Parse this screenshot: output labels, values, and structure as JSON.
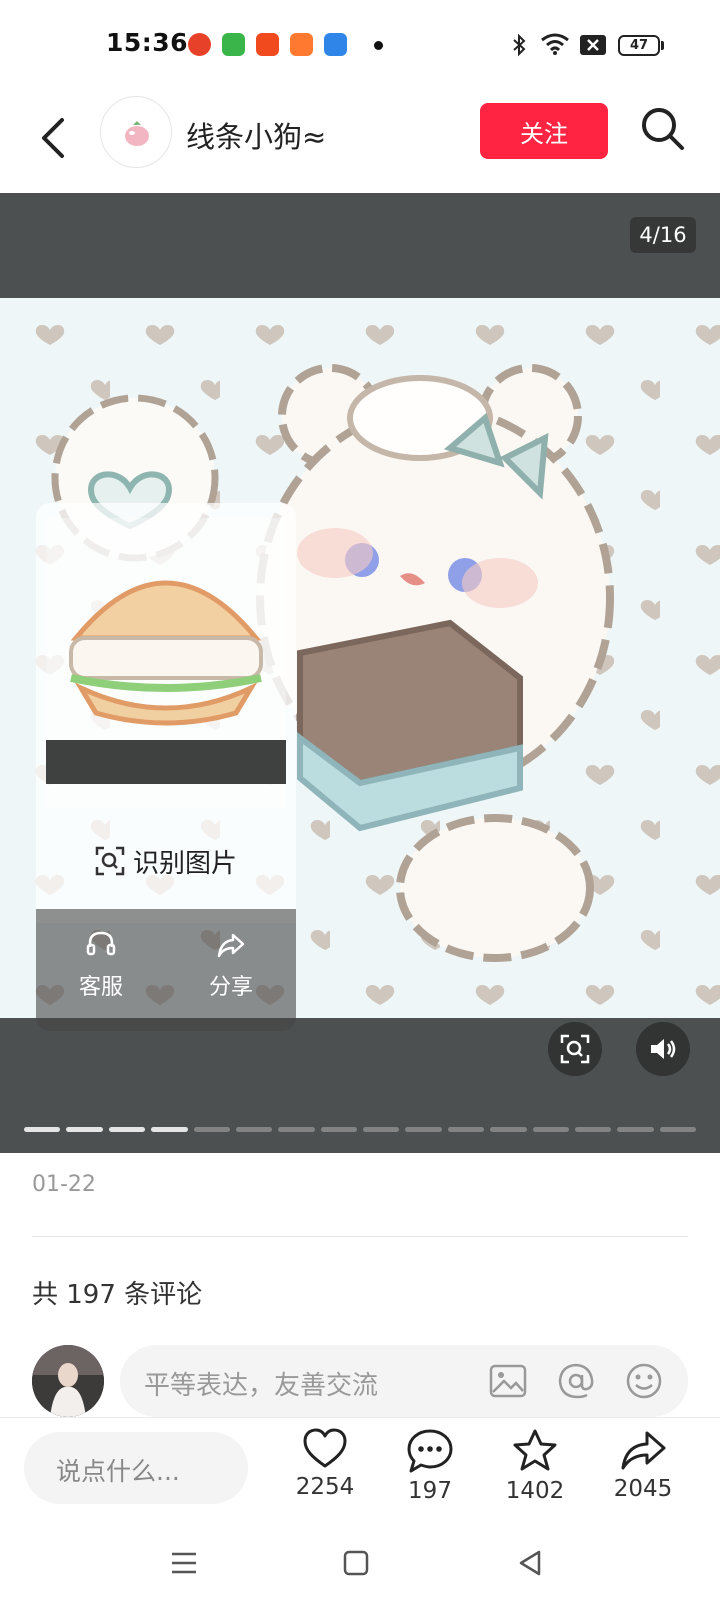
{
  "status_bar": {
    "time": "15:36",
    "battery": "47",
    "app_icons": [
      {
        "name": "app-icon-red",
        "color": "#e8412a"
      },
      {
        "name": "app-icon-green",
        "color": "#3ab54a"
      },
      {
        "name": "app-icon-play",
        "color": "#f04a1e"
      },
      {
        "name": "app-icon-game",
        "color": "#ff7a30"
      },
      {
        "name": "app-icon-blue",
        "color": "#2f86e8"
      }
    ],
    "icons": [
      "bluetooth-icon",
      "wifi-icon",
      "no-sim-icon",
      "battery-icon"
    ]
  },
  "header": {
    "author_name": "线条小狗≈",
    "follow_label": "关注",
    "follow_color": "#ff2442"
  },
  "media": {
    "page_counter": "4/16",
    "total_pages": 16,
    "current_page": 4
  },
  "overlay": {
    "recognize_label": "识别图片",
    "actions": [
      {
        "label": "客服",
        "icon": "headset-icon"
      },
      {
        "label": "分享",
        "icon": "share-icon"
      }
    ],
    "thumb_date": "01-22"
  },
  "post": {
    "date": "01-22",
    "comment_count_text": "共 197 条评论"
  },
  "comment_input": {
    "placeholder": "平等表达，友善交流",
    "icons": [
      "image-icon",
      "at-icon",
      "emoji-icon"
    ]
  },
  "bottom_bar": {
    "say_placeholder": "说点什么...",
    "likes": "2254",
    "comments": "197",
    "collects": "1402",
    "shares": "2045"
  },
  "nav": [
    "menu-icon",
    "home-icon",
    "back-triangle-icon"
  ]
}
